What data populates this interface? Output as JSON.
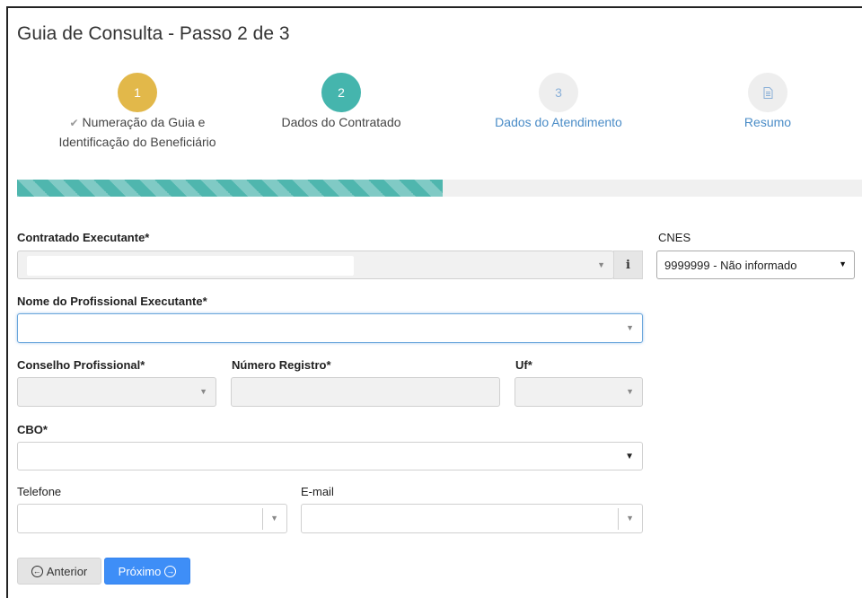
{
  "page": {
    "title": "Guia de Consulta - Passo 2 de 3"
  },
  "steps": [
    {
      "number": "1",
      "check": "✔",
      "label_line1": "Numeração da Guia e",
      "label_line2": "Identificação do Beneficiário",
      "color": "#e2b84a"
    },
    {
      "number": "2",
      "label": "Dados do Contratado",
      "color": "#45b5ad"
    },
    {
      "number": "3",
      "label": "Dados do Atendimento"
    },
    {
      "icon": "document-icon",
      "label": "Resumo"
    }
  ],
  "progress": {
    "percent": 50
  },
  "form": {
    "contratado": {
      "label": "Contratado Executante*",
      "value": ""
    },
    "info_button": {
      "glyph": "i"
    },
    "cnes": {
      "label": "CNES",
      "selected": "9999999 - Não informado"
    },
    "profissional": {
      "label": "Nome do Profissional Executante*",
      "value": ""
    },
    "conselho": {
      "label": "Conselho Profissional*",
      "value": ""
    },
    "registro": {
      "label": "Número Registro*",
      "value": ""
    },
    "uf": {
      "label": "Uf*",
      "value": ""
    },
    "cbo": {
      "label": "CBO*",
      "value": ""
    },
    "telefone": {
      "label": "Telefone",
      "value": ""
    },
    "email": {
      "label": "E-mail",
      "value": ""
    }
  },
  "buttons": {
    "prev": "Anterior",
    "next": "Próximo"
  },
  "colors": {
    "accent": "#3e8ef7",
    "teal": "#45b5ad",
    "yellow": "#e2b84a"
  }
}
